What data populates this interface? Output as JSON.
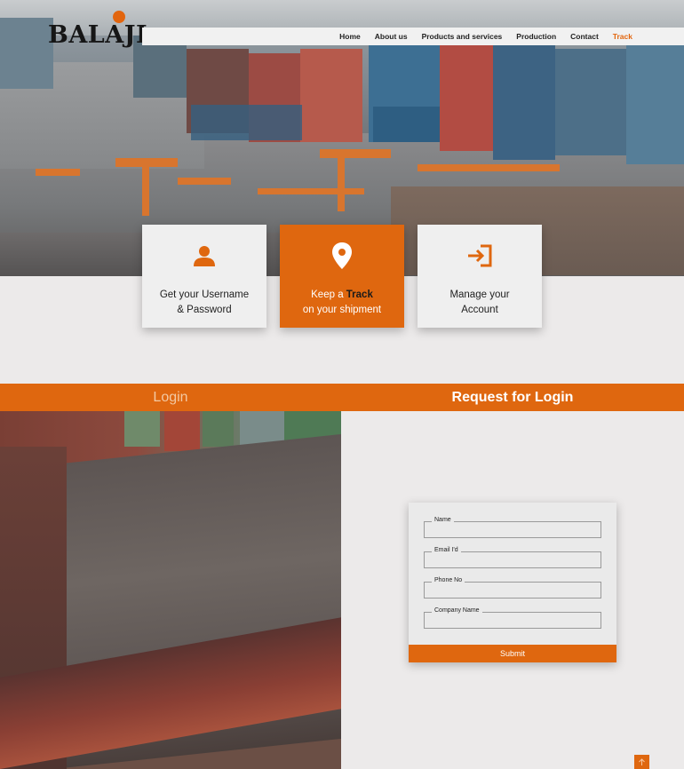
{
  "brand": {
    "logo_text": "BALAJI",
    "accent": "#df670f"
  },
  "nav": {
    "items": [
      {
        "label": "Home"
      },
      {
        "label": "About us"
      },
      {
        "label": "Products and services"
      },
      {
        "label": "Production"
      },
      {
        "label": "Contact"
      },
      {
        "label": "Track",
        "active": true
      }
    ]
  },
  "cards": [
    {
      "icon": "user-icon",
      "line1": "Get your Username",
      "line2": "& Password"
    },
    {
      "icon": "location-pin-icon",
      "line1_prefix": "Keep a ",
      "line1_bold": "Track",
      "line2": "on your shipment"
    },
    {
      "icon": "sign-in-icon",
      "line1": "Manage your",
      "line2": "Account"
    }
  ],
  "tabs": {
    "login": "Login",
    "request": "Request for Login"
  },
  "form": {
    "fields": [
      {
        "label": "Name"
      },
      {
        "label": "Email I'd"
      },
      {
        "label": "Phone No"
      },
      {
        "label": "Company Name"
      }
    ],
    "submit_label": "Submit"
  },
  "scroll_top": {
    "icon": "arrow-up-icon"
  }
}
